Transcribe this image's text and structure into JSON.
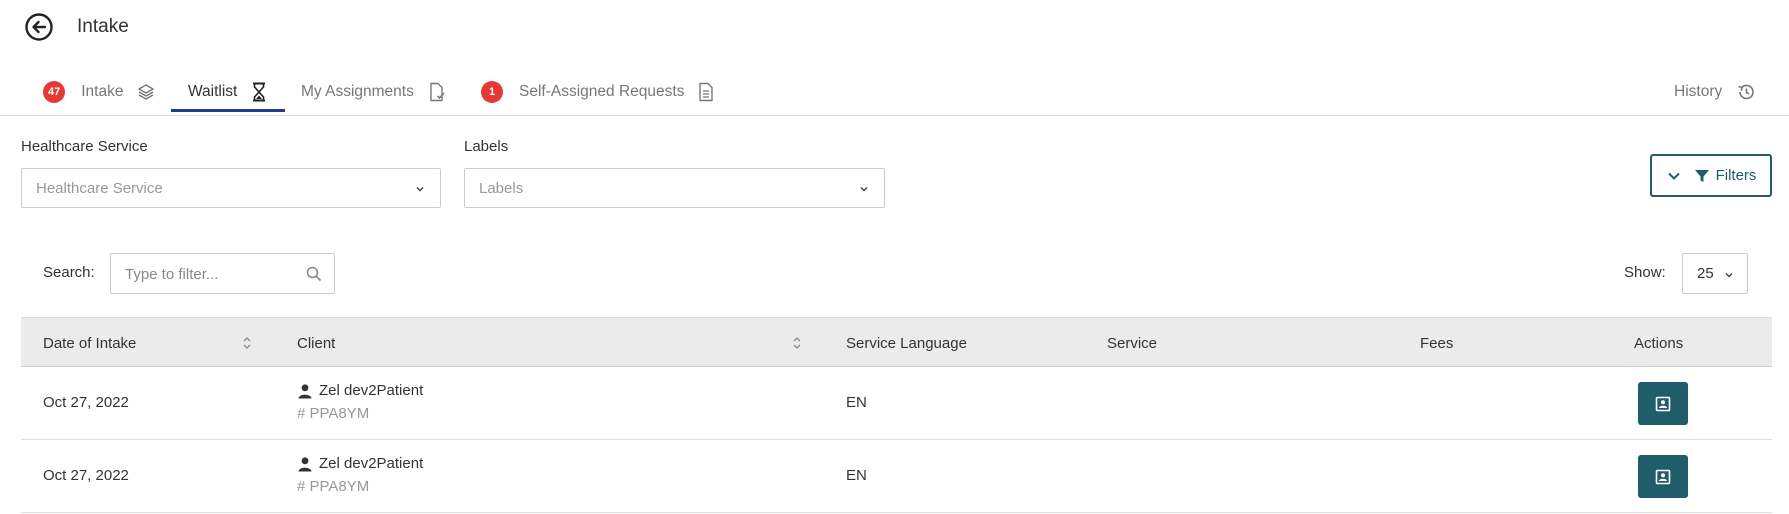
{
  "header": {
    "title": "Intake",
    "back_icon": "arrow-left-circle-icon"
  },
  "tabs": [
    {
      "label": "Intake",
      "badge": "47",
      "icon": "layers-icon",
      "active": false
    },
    {
      "label": "Waitlist",
      "badge": null,
      "icon": "hourglass-icon",
      "active": true
    },
    {
      "label": "My Assignments",
      "badge": null,
      "icon": "document-check-icon",
      "active": false
    },
    {
      "label": "Self-Assigned Requests",
      "badge": "1",
      "icon": "document-icon",
      "active": false
    }
  ],
  "history": {
    "label": "History",
    "icon": "history-icon"
  },
  "filters": {
    "healthcare_service": {
      "label": "Healthcare Service",
      "placeholder": "Healthcare Service"
    },
    "labels": {
      "label": "Labels",
      "placeholder": "Labels"
    },
    "button_label": "Filters"
  },
  "search": {
    "label": "Search:",
    "placeholder": "Type to filter..."
  },
  "show": {
    "label": "Show:",
    "value": "25"
  },
  "table": {
    "columns": [
      "Date of Intake",
      "Client",
      "Service Language",
      "Service",
      "Fees",
      "Actions"
    ],
    "rows": [
      {
        "date": "Oct 27, 2022",
        "client_name": "Zel dev2Patient",
        "client_id": "# PPA8YM",
        "language": "EN",
        "service": "",
        "fees": ""
      },
      {
        "date": "Oct 27, 2022",
        "client_name": "Zel dev2Patient",
        "client_id": "# PPA8YM",
        "language": "EN",
        "service": "",
        "fees": ""
      }
    ]
  },
  "colors": {
    "accent": "#1f5d6b",
    "tab_underline": "#1f3d8a",
    "badge": "#e53935",
    "header_row": "#ebebeb"
  }
}
